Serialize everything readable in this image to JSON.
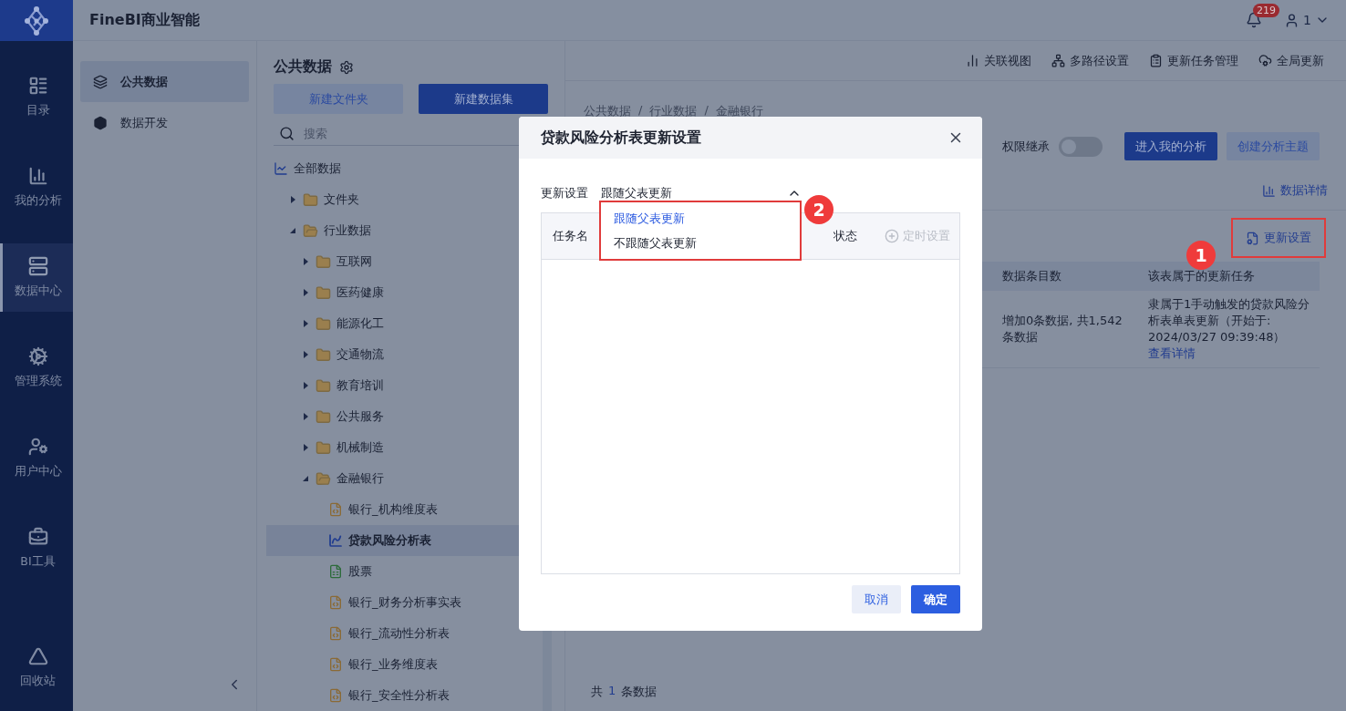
{
  "app": {
    "title": "FineBI商业智能",
    "notification_count": "219",
    "user": "1"
  },
  "nav": [
    {
      "label": "目录",
      "kind": "catalog",
      "selected": false
    },
    {
      "label": "我的分析",
      "kind": "analysis",
      "selected": false
    },
    {
      "label": "数据中心",
      "kind": "data",
      "selected": true
    },
    {
      "label": "管理系统",
      "kind": "admin",
      "selected": false
    },
    {
      "label": "用户中心",
      "kind": "users",
      "selected": false
    },
    {
      "label": "BI工具",
      "kind": "tools",
      "selected": false
    },
    {
      "label": "回收站",
      "kind": "trash",
      "selected": false
    }
  ],
  "subnav": [
    {
      "label": "公共数据",
      "kind": "public",
      "selected": true
    },
    {
      "label": "数据开发",
      "kind": "dev",
      "selected": false
    }
  ],
  "tree_panel": {
    "title": "公共数据",
    "buttons": [
      {
        "label": "新建文件夹",
        "kind": "secondary"
      },
      {
        "label": "新建数据集",
        "kind": "primary"
      }
    ],
    "search": {
      "placeholder": "搜索"
    },
    "tree": [
      {
        "label": "全部数据",
        "kind": "root",
        "selected": false,
        "expanded": true,
        "children": [
          {
            "label": "文件夹",
            "kind": "folder",
            "selected": false,
            "expanded": false
          },
          {
            "label": "行业数据",
            "kind": "folder",
            "selected": false,
            "expanded": true,
            "children": [
              {
                "label": "互联网",
                "kind": "folder",
                "selected": false,
                "expanded": false
              },
              {
                "label": "医药健康",
                "kind": "folder",
                "selected": false,
                "expanded": false
              },
              {
                "label": "能源化工",
                "kind": "folder",
                "selected": false,
                "expanded": false
              },
              {
                "label": "交通物流",
                "kind": "folder",
                "selected": false,
                "expanded": false
              },
              {
                "label": "教育培训",
                "kind": "folder",
                "selected": false,
                "expanded": false
              },
              {
                "label": "公共服务",
                "kind": "folder",
                "selected": false,
                "expanded": false
              },
              {
                "label": "机械制造",
                "kind": "folder",
                "selected": false,
                "expanded": false
              },
              {
                "label": "金融银行",
                "kind": "folder",
                "selected": false,
                "expanded": true,
                "children": [
                  {
                    "label": "银行_机构维度表",
                    "kind": "sql",
                    "selected": false
                  },
                  {
                    "label": "贷款风险分析表",
                    "kind": "analysis",
                    "selected": true
                  },
                  {
                    "label": "股票",
                    "kind": "xls",
                    "selected": false
                  },
                  {
                    "label": "银行_财务分析事实表",
                    "kind": "sql",
                    "selected": false
                  },
                  {
                    "label": "银行_流动性分析表",
                    "kind": "sql",
                    "selected": false
                  },
                  {
                    "label": "银行_业务维度表",
                    "kind": "sql",
                    "selected": false
                  },
                  {
                    "label": "银行_安全性分析表",
                    "kind": "sql",
                    "selected": false
                  }
                ]
              }
            ]
          }
        ]
      }
    ]
  },
  "toolbar": [
    {
      "label": "关联视图",
      "kind": "relation"
    },
    {
      "label": "多路径设置",
      "kind": "paths"
    },
    {
      "label": "更新任务管理",
      "kind": "tasks"
    },
    {
      "label": "全局更新",
      "kind": "global"
    }
  ],
  "breadcrumb": {
    "separator": "/",
    "items": [
      "公共数据",
      "行业数据",
      "金融银行"
    ]
  },
  "permission": {
    "label": "权限继承",
    "on": false
  },
  "actions": [
    {
      "label": "进入我的分析",
      "kind": "primary"
    },
    {
      "label": "创建分析主题",
      "kind": "secondary"
    }
  ],
  "data_detail": "数据详情",
  "update_settings": "更新设置",
  "table": {
    "columns": [
      "数据条目数",
      "该表属于的更新任务"
    ],
    "rows": [
      {
        "count": "增加0条数据, 共1,542条数据",
        "task": "隶属于1手动触发的贷款风险分析表单表更新（开始于: 2024/03/27 09:39:48）",
        "link": "查看详情"
      }
    ]
  },
  "footer": {
    "prefix": "共",
    "count": "1",
    "suffix": "条数据"
  },
  "dialog": {
    "title": "贷款风险分析表更新设置",
    "field_label": "更新设置",
    "value": "跟随父表更新",
    "expanded": true,
    "options": [
      {
        "label": "跟随父表更新",
        "selected": true
      },
      {
        "label": "不跟随父表更新",
        "selected": false
      }
    ],
    "columns": [
      {
        "label": "任务名",
        "kind": "text"
      },
      {
        "label": "状态",
        "kind": "text"
      },
      {
        "label": "定时设置",
        "kind": "add"
      }
    ],
    "buttons": [
      {
        "label": "取消",
        "kind": "secondary"
      },
      {
        "label": "确定",
        "kind": "primary"
      }
    ]
  },
  "annotations": [
    {
      "label": "1"
    },
    {
      "label": "2"
    }
  ]
}
